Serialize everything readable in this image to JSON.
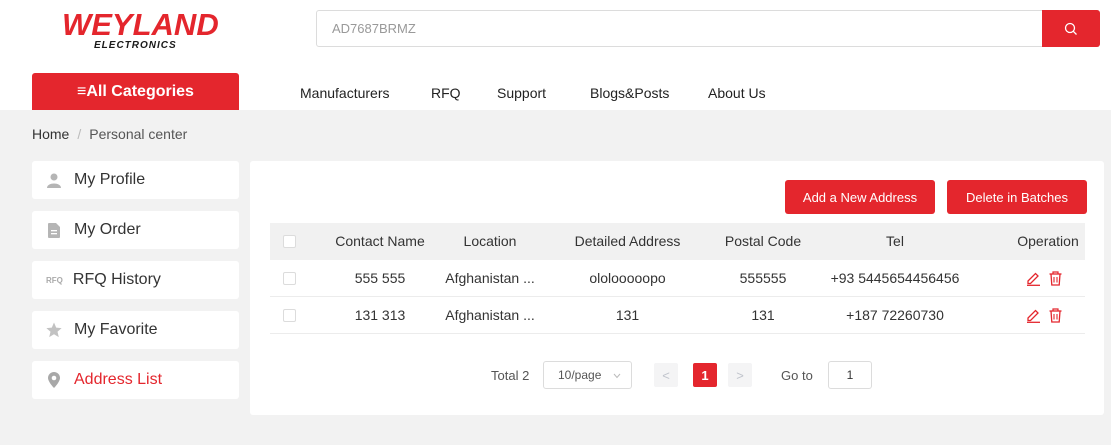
{
  "logo": {
    "main": "WEYLAND",
    "sub": "ELECTRONICS"
  },
  "search": {
    "value": "AD7687BRMZ",
    "button_icon": "search-icon"
  },
  "nav": {
    "all_categories": "≡All Categories",
    "links": [
      "Manufacturers",
      "RFQ",
      "Support",
      "Blogs&Posts",
      "About Us"
    ]
  },
  "breadcrumb": {
    "home": "Home",
    "separator": "/",
    "current": "Personal center"
  },
  "sidebar": {
    "items": [
      {
        "label": "My Profile",
        "icon": "user-icon"
      },
      {
        "label": "My Order",
        "icon": "document-icon"
      },
      {
        "label": "RFQ History",
        "icon": "rfq-icon",
        "icon_text": "RFQ"
      },
      {
        "label": "My Favorite",
        "icon": "star-icon"
      },
      {
        "label": "Address List",
        "icon": "location-pin-icon",
        "active": true
      }
    ]
  },
  "actions": {
    "add": "Add a New Address",
    "delete": "Delete in Batches"
  },
  "table": {
    "columns": [
      "Contact Name",
      "Location",
      "Detailed Address",
      "Postal Code",
      "Tel",
      "Operation"
    ],
    "rows": [
      {
        "contact": "555 555",
        "location": "Afghanistan ...",
        "address": "ololooooopo",
        "postal": "555555",
        "tel": "+93 5445654456456"
      },
      {
        "contact": "131 313",
        "location": "Afghanistan ...",
        "address": "131",
        "postal": "131",
        "tel": "+187 72260730"
      }
    ]
  },
  "pagination": {
    "total": "Total 2",
    "page_size": "10/page",
    "prev": "<",
    "current": "1",
    "next": ">",
    "goto_label": "Go to",
    "goto_value": "1"
  },
  "colors": {
    "brand": "#e4262d",
    "background": "#f2f2f2"
  }
}
